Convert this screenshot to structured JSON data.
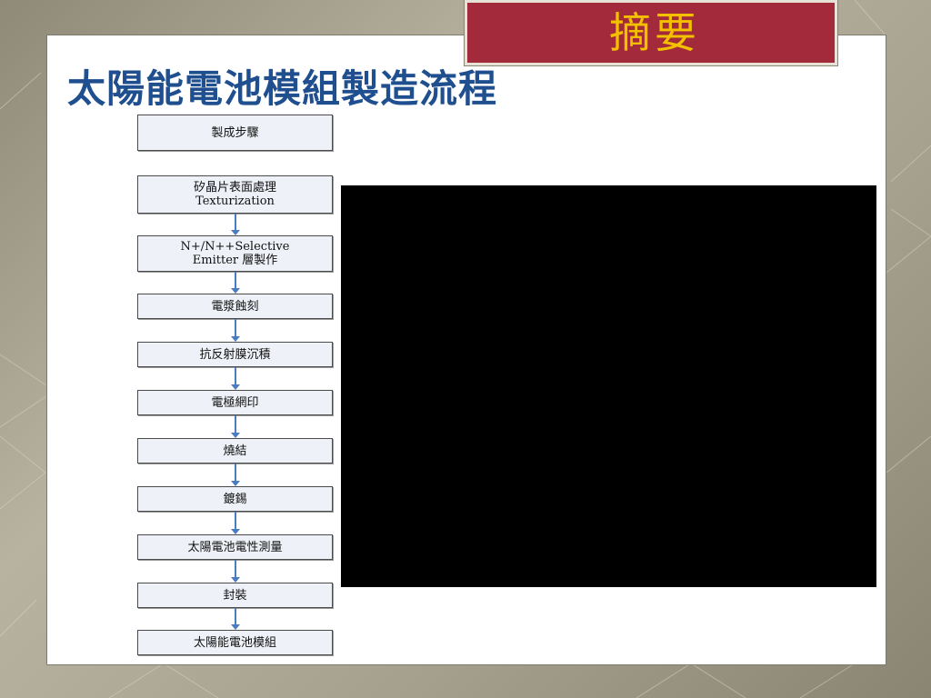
{
  "banner": {
    "label": "摘要"
  },
  "title": "太陽能電池模組製造流程",
  "flow": {
    "steps": [
      {
        "line1": "製成步驟",
        "line2": ""
      },
      {
        "line1": "矽晶片表面處理",
        "line2": "Texturization"
      },
      {
        "line1": "N+/N++Selective",
        "line2": "Emitter 層製作"
      },
      {
        "line1": "電漿蝕刻",
        "line2": ""
      },
      {
        "line1": "抗反射膜沉積",
        "line2": ""
      },
      {
        "line1": "電極網印",
        "line2": ""
      },
      {
        "line1": "燒結",
        "line2": ""
      },
      {
        "line1": "鍍錫",
        "line2": ""
      },
      {
        "line1": "太陽電池電性測量",
        "line2": ""
      },
      {
        "line1": "封裝",
        "line2": ""
      },
      {
        "line1": "太陽能電池模組",
        "line2": ""
      }
    ]
  },
  "colors": {
    "title": "#1f4f8f",
    "banner_bg": "#a32a3a",
    "banner_text": "#f3c000",
    "arrow": "#4a7cc0",
    "step_bg": "#eef1f7"
  }
}
